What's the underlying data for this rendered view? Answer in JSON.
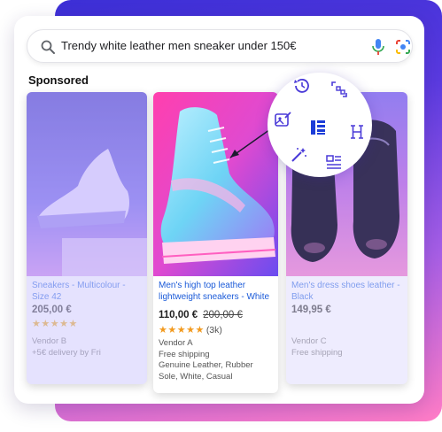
{
  "search": {
    "query": "Trendy white leather men sneaker under 150€"
  },
  "section": {
    "label": "Sponsored"
  },
  "products": [
    {
      "title_lines": [
        "Sneakers - Multicolour -",
        "Size 42"
      ],
      "price": "205,00 €",
      "stars": "★★★★★",
      "vendor": "Vendor B",
      "delivery": "+5€ delivery by Fri"
    },
    {
      "title_lines": [
        "Men's high top leather",
        "lightweight sneakers - White"
      ],
      "price": "110,00 €",
      "old_price": "200,00 €",
      "stars": "★★★★★",
      "rating_count": "(3k)",
      "vendor": "Vendor A",
      "delivery": "Free shipping",
      "detail_lines": [
        "Genuine Leather, Rubber",
        "Sole, White, Casual"
      ]
    },
    {
      "title_lines": [
        "Men's dress shoes leather -",
        "Black"
      ],
      "price": "149,95 €",
      "vendor": "Vendor C",
      "delivery": "Free shipping"
    }
  ],
  "tool_icons": [
    "history-icon",
    "grid-scan-icon",
    "image-edit-icon",
    "layout-select-icon",
    "heading-icon",
    "magic-wand-icon",
    "text-layout-icon"
  ],
  "colors": {
    "accent": "#1a5ad8",
    "tool_icon": "#4a3ad8",
    "star": "#f29a1f",
    "brand_gradient_start": "#3c2fd6",
    "brand_gradient_end": "#ff7cc6"
  }
}
